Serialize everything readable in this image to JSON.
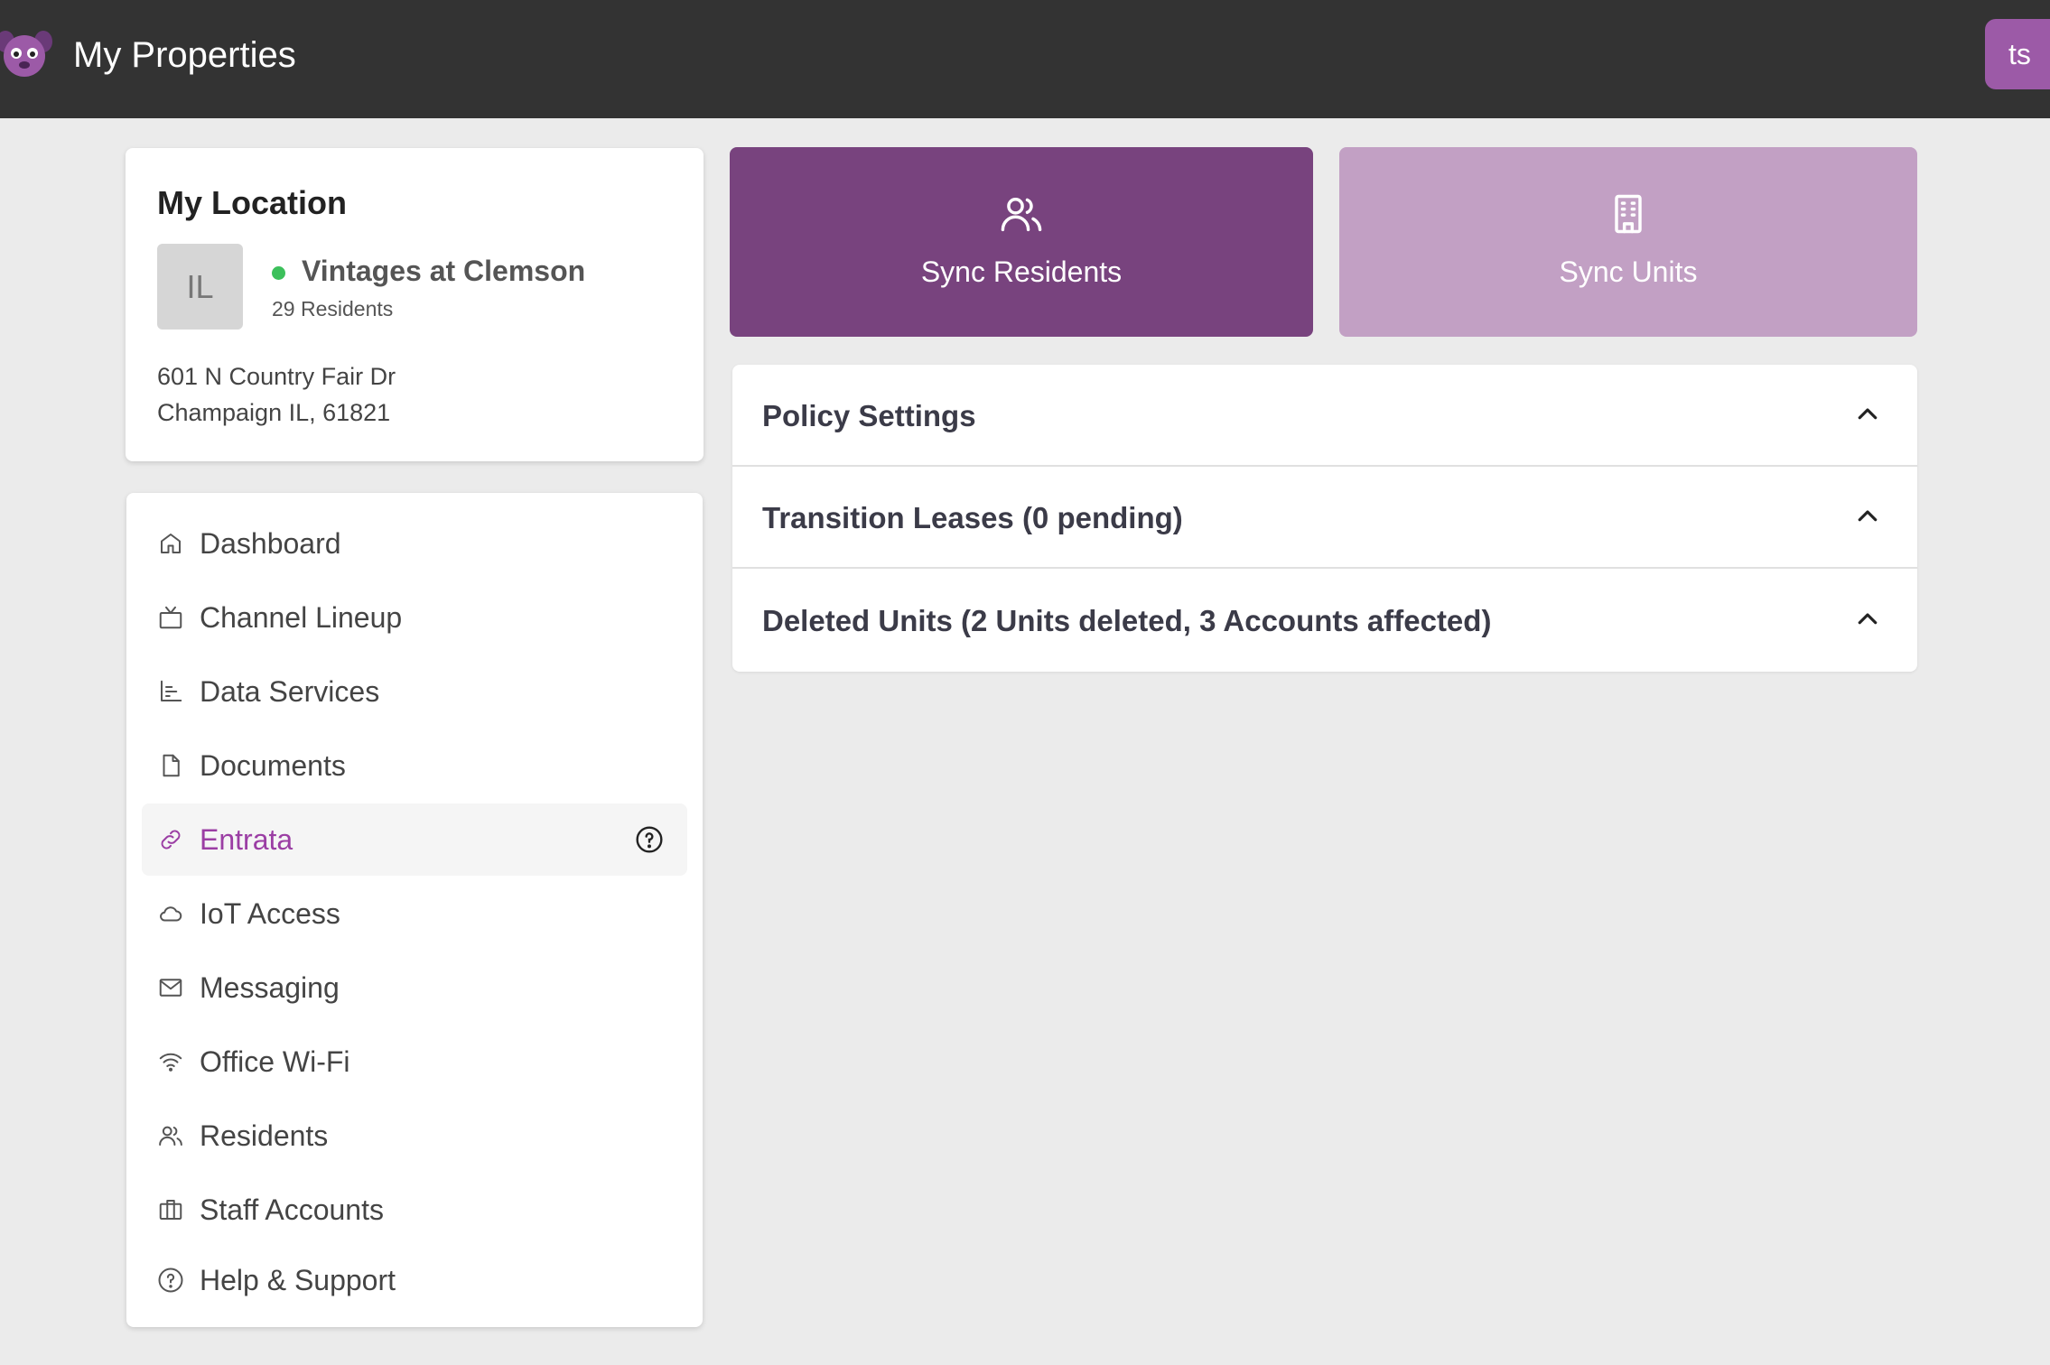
{
  "header": {
    "title": "My Properties",
    "logo_icon": "mascot-logo-icon",
    "user_initials": "ts",
    "accent_color": "#9c5aa7",
    "bar_color": "#333333"
  },
  "location": {
    "heading": "My Location",
    "avatar_initials": "IL",
    "property_name": "Vintages at Clemson",
    "status_color": "#3cc05b",
    "residents": "29 Residents",
    "address_line1": "601 N Country Fair Dr",
    "address_line2": "Champaign IL, 61821"
  },
  "nav": {
    "items": [
      {
        "label": "Dashboard",
        "icon": "home-icon"
      },
      {
        "label": "Channel Lineup",
        "icon": "tv-icon"
      },
      {
        "label": "Data Services",
        "icon": "bar-chart-icon"
      },
      {
        "label": "Documents",
        "icon": "document-icon"
      },
      {
        "label": "Entrata",
        "icon": "link-icon",
        "active": true
      },
      {
        "label": "IoT Access",
        "icon": "cloud-icon"
      },
      {
        "label": "Messaging",
        "icon": "mail-icon"
      },
      {
        "label": "Office Wi-Fi",
        "icon": "wifi-icon"
      },
      {
        "label": "Residents",
        "icon": "users-icon"
      },
      {
        "label": "Staff Accounts",
        "icon": "briefcase-icon"
      },
      {
        "label": "Help & Support",
        "icon": "help-circle-icon"
      }
    ],
    "active_color": "#9b3ea4"
  },
  "sync": {
    "residents_label": "Sync Residents",
    "units_label": "Sync Units",
    "residents_color": "#78437e",
    "units_color": "#c2a0c4"
  },
  "accordion": {
    "sections": [
      {
        "title": "Policy Settings"
      },
      {
        "title": "Transition Leases (0 pending)"
      },
      {
        "title": "Deleted Units (2 Units deleted, 3 Accounts affected)"
      }
    ]
  }
}
